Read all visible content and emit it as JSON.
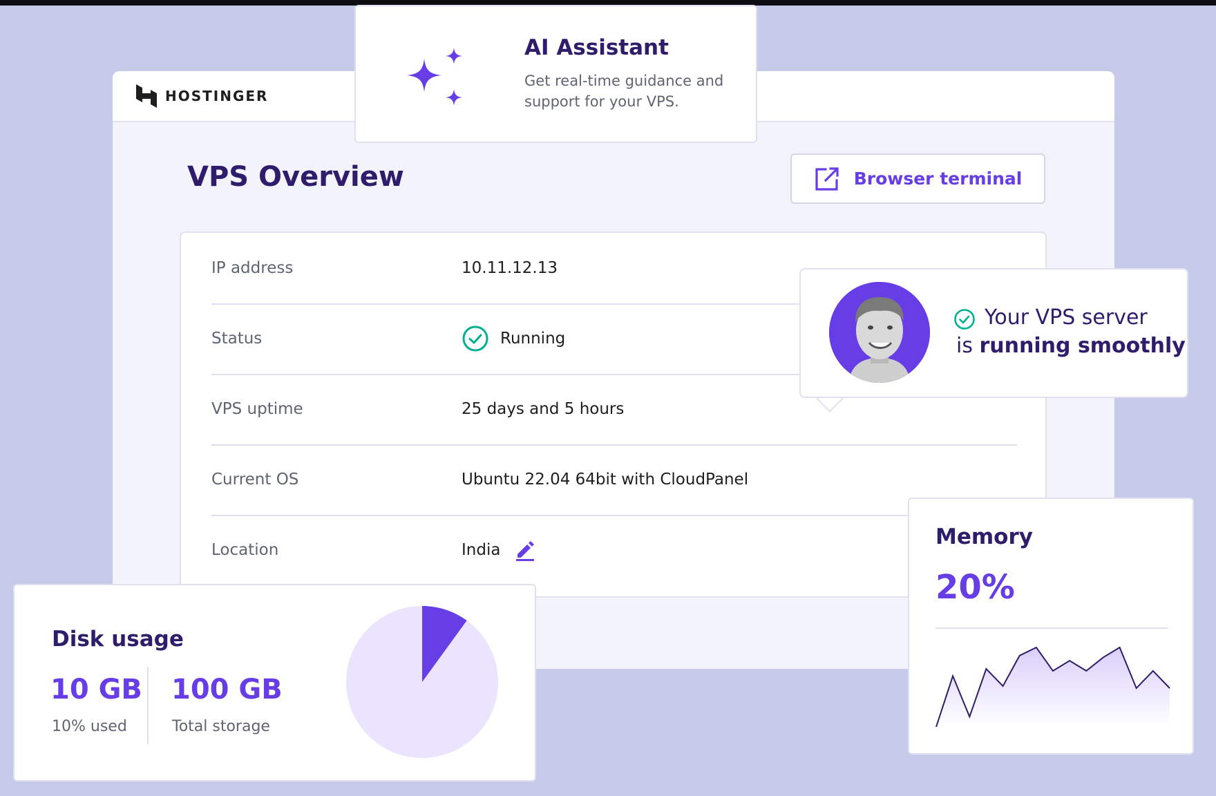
{
  "brand": {
    "name": "HOSTINGER"
  },
  "ai_assistant": {
    "title": "AI Assistant",
    "description": "Get real-time guidance and support for your VPS."
  },
  "overview": {
    "title": "VPS Overview",
    "terminal_button": "Browser terminal",
    "rows": [
      {
        "label": "IP address",
        "value": "10.11.12.13"
      },
      {
        "label": "Status",
        "value": "Running"
      },
      {
        "label": "VPS uptime",
        "value": "25 days and 5 hours"
      },
      {
        "label": "Current OS",
        "value": "Ubuntu 22.04 64bit with CloudPanel"
      },
      {
        "label": "Location",
        "value": "India"
      }
    ]
  },
  "status_bubble": {
    "line1": "Your VPS server",
    "line2_prefix": "is ",
    "line2_bold": "running smoothly"
  },
  "disk": {
    "title": "Disk usage",
    "used_value": "10 GB",
    "used_label": "10% used",
    "total_value": "100 GB",
    "total_label": "Total storage",
    "used_fraction": 0.1
  },
  "memory": {
    "title": "Memory",
    "value": "20%",
    "series": [
      0,
      50,
      10,
      57,
      40,
      70,
      78,
      55,
      65,
      55,
      68,
      78,
      38,
      55,
      38
    ]
  },
  "colors": {
    "accent": "#673de6",
    "heading": "#2f1c6a",
    "success": "#00b090",
    "pie_bg": "#ebe4ff"
  }
}
